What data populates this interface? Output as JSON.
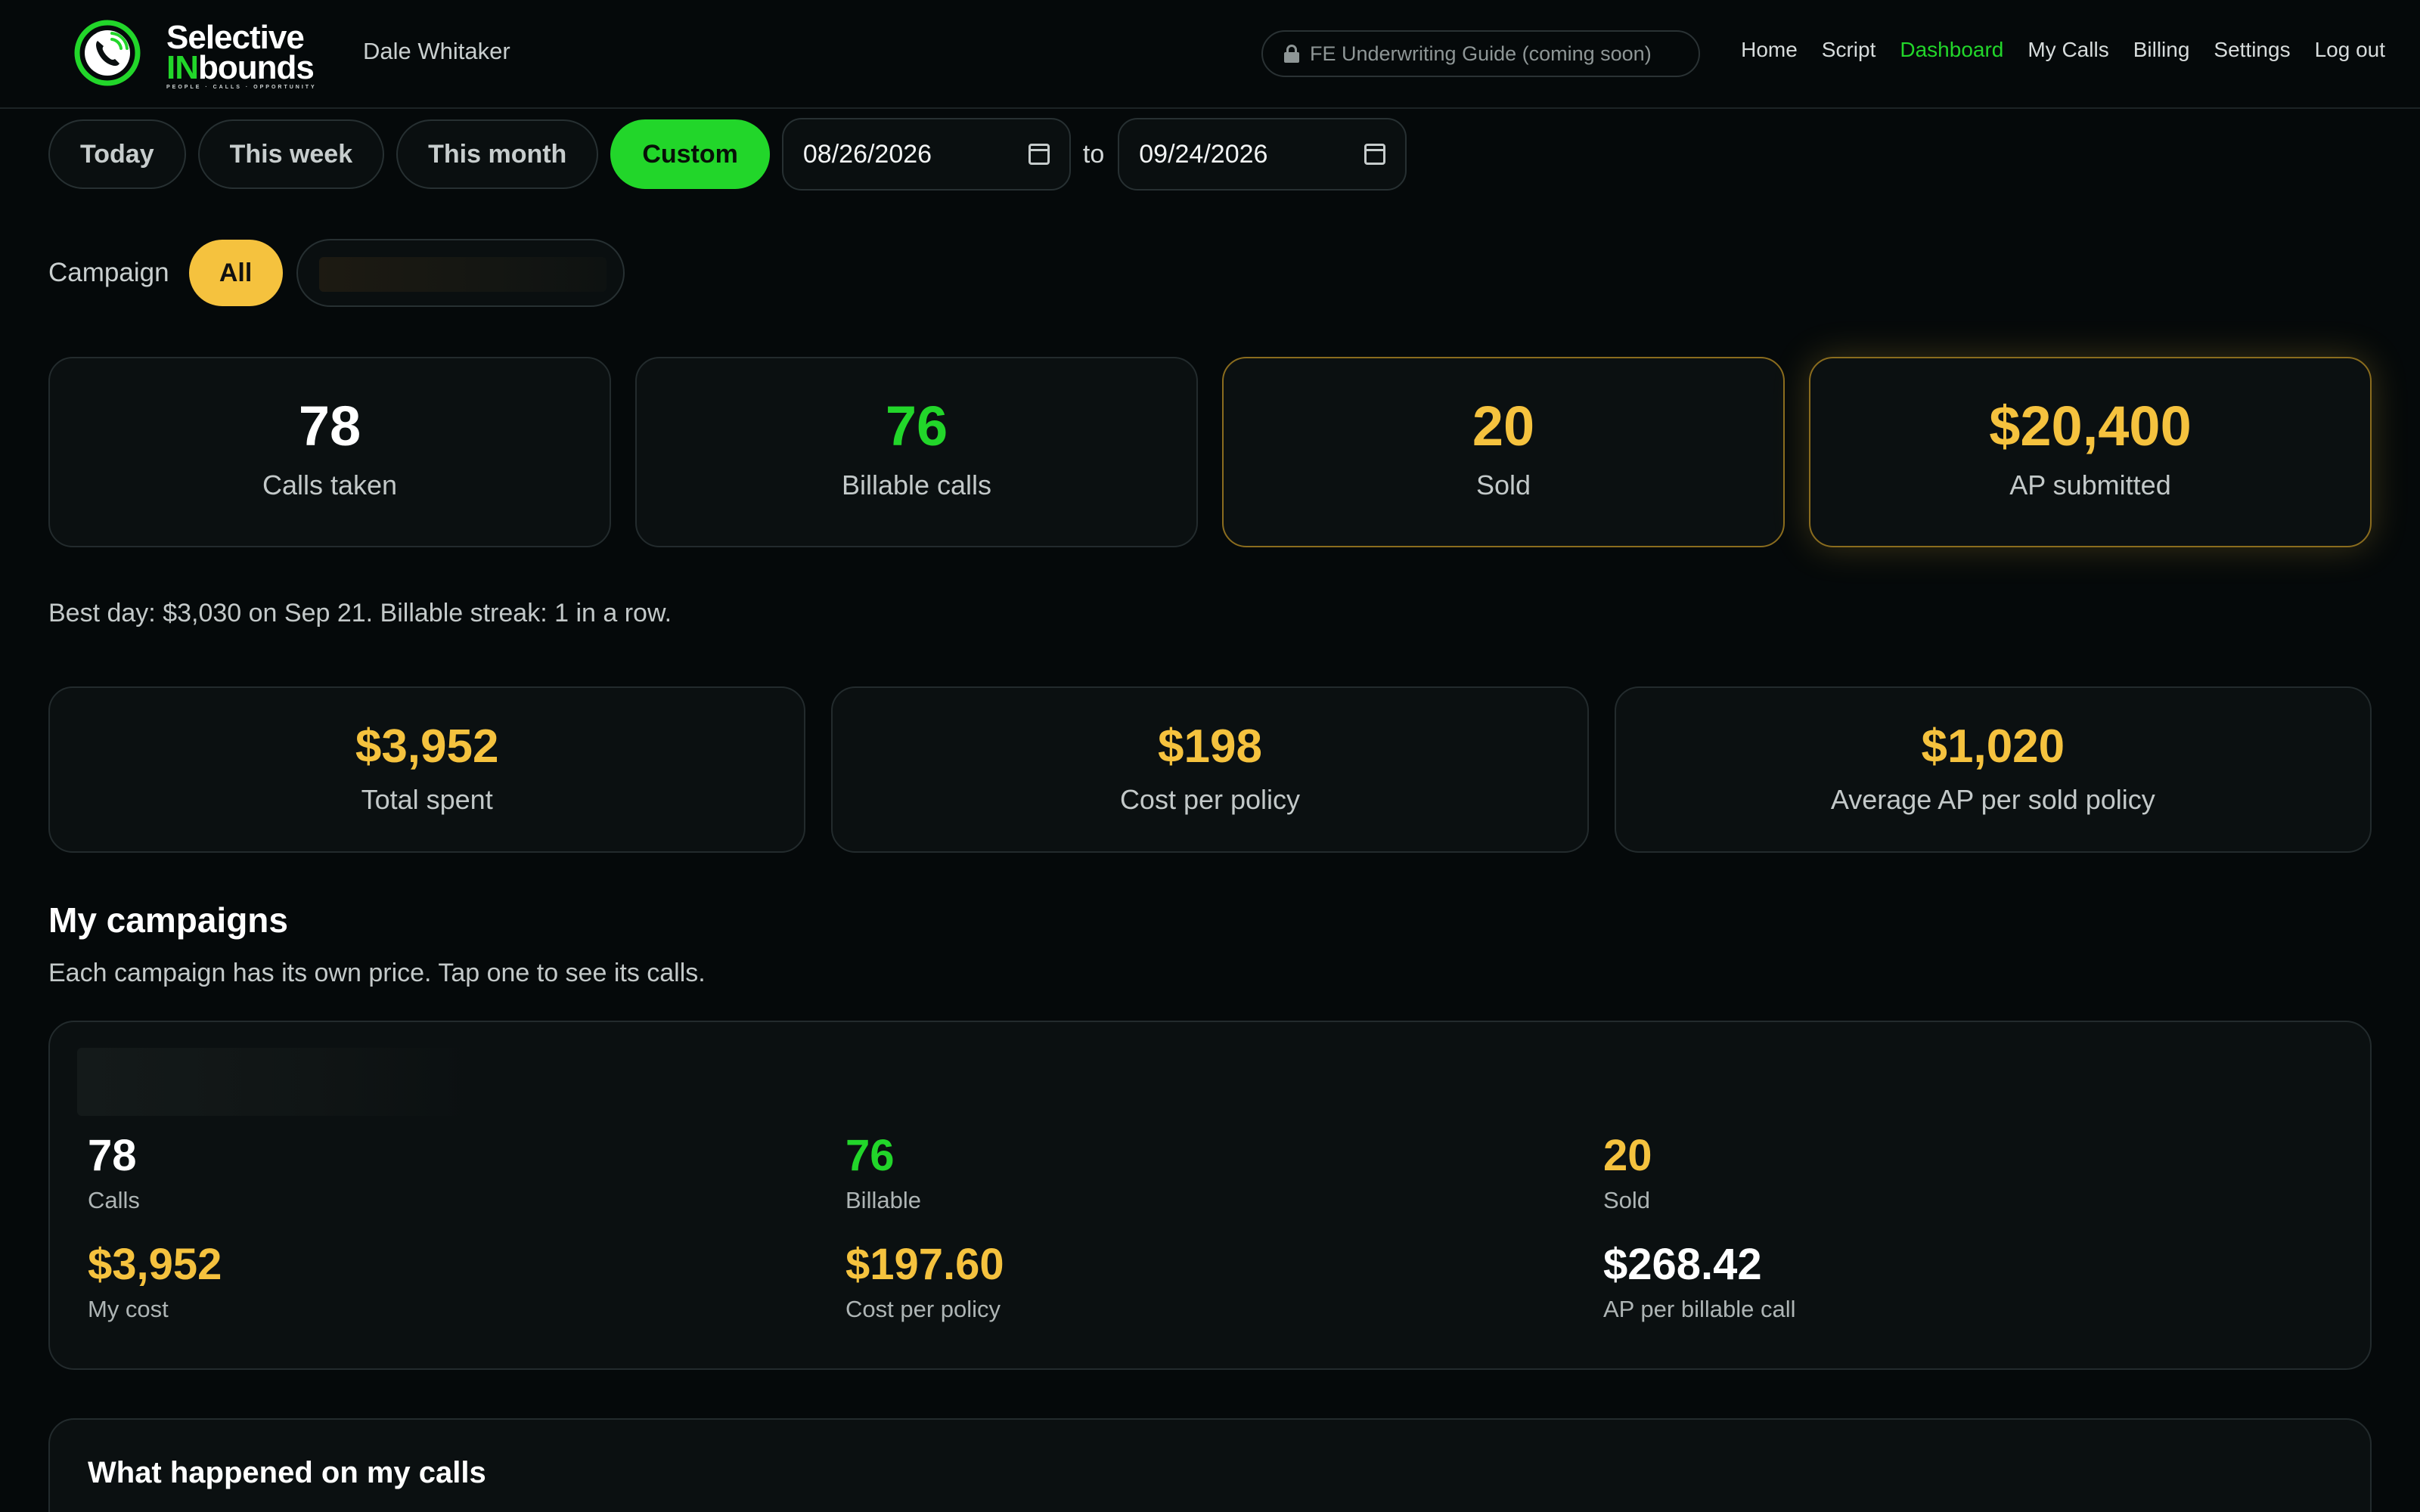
{
  "header": {
    "logo": {
      "line1": "Selective",
      "line2_accent": "IN",
      "line2_rest": "bounds",
      "tagline": "PEOPLE · CALLS · OPPORTUNITY"
    },
    "user_name": "Dale Whitaker",
    "guide_label": "FE Underwriting Guide (coming soon)",
    "nav": {
      "home": "Home",
      "script": "Script",
      "dashboard": "Dashboard",
      "my_calls": "My Calls",
      "billing": "Billing",
      "settings": "Settings",
      "logout": "Log out"
    }
  },
  "date_filter": {
    "today": "Today",
    "this_week": "This week",
    "this_month": "This month",
    "custom": "Custom",
    "selected": "Custom",
    "from": "08/26/2026",
    "to_label": "to",
    "to": "09/24/2026"
  },
  "campaign_filter": {
    "label": "Campaign",
    "all": "All",
    "selected": "All"
  },
  "stats": [
    {
      "value": "78",
      "label": "Calls taken"
    },
    {
      "value": "76",
      "label": "Billable calls"
    },
    {
      "value": "20",
      "label": "Sold"
    },
    {
      "value": "$20,400",
      "label": "AP submitted"
    }
  ],
  "best_day_text": "Best day: $3,030 on Sep 21. Billable streak: 1 in a row.",
  "money": [
    {
      "value": "$3,952",
      "label": "Total spent"
    },
    {
      "value": "$198",
      "label": "Cost per policy"
    },
    {
      "value": "$1,020",
      "label": "Average AP per sold policy"
    }
  ],
  "campaigns": {
    "title": "My campaigns",
    "subtitle": "Each campaign has its own price. Tap one to see its calls.",
    "card": {
      "calls": {
        "value": "78",
        "label": "Calls"
      },
      "billable": {
        "value": "76",
        "label": "Billable"
      },
      "sold": {
        "value": "20",
        "label": "Sold"
      },
      "my_cost": {
        "value": "$3,952",
        "label": "My cost"
      },
      "cost_per_policy": {
        "value": "$197.60",
        "label": "Cost per policy"
      },
      "ap_per_billable": {
        "value": "$268.42",
        "label": "AP per billable call"
      }
    }
  },
  "happened": {
    "title": "What happened on my calls"
  },
  "colors": {
    "background": "#05090a",
    "green": "#22d62a",
    "gold": "#f5c23e",
    "card": "#0b1011",
    "border": "#232b2d"
  },
  "icons": [
    "phone-logo-icon",
    "lock-icon",
    "calendar-icon"
  ]
}
